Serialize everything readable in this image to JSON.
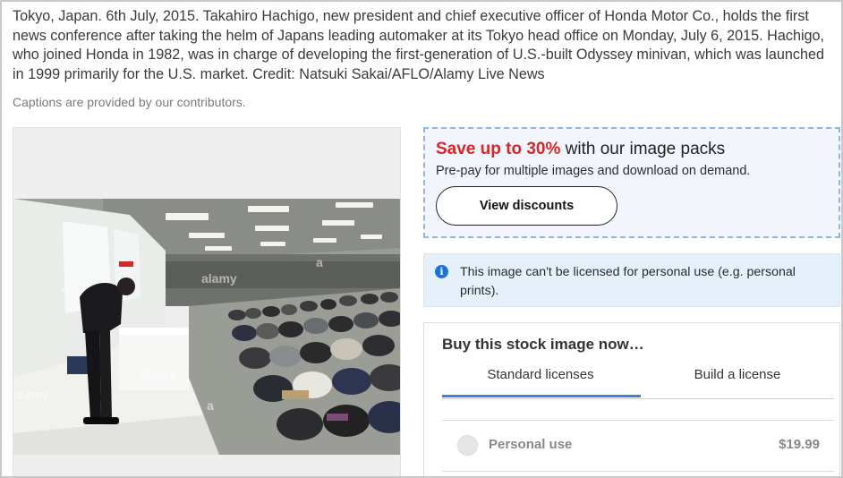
{
  "caption": {
    "text": "Tokyo, Japan. 6th July, 2015. Takahiro Hachigo, new president and chief executive officer of Honda Motor Co., holds the first news conference after taking the helm of Japans leading automaker at its Tokyo head office on Monday, July 6, 2015. Hachigo, who joined Honda in 1982, was in charge of developing the first-generation of U.S.-built Odyssey minivan, which was launched in 1999 primarily for the U.S. market. Credit: Natsuki Sakai/AFLO/Alamy Live News",
    "note": "Captions are provided by our contributors."
  },
  "image": {
    "watermark": "alamy",
    "subject": "Man bowing at a press conference before seated photographers"
  },
  "promo": {
    "title_accent": "Save up to 30%",
    "title_rest": " with our image packs",
    "subtitle": "Pre-pay for multiple images and download on demand.",
    "button_label": "View discounts",
    "accent_color": "#d42727"
  },
  "info": {
    "icon": "info-icon",
    "icon_glyph": "i",
    "text": "This image can't be licensed for personal use (e.g. personal prints)."
  },
  "buy": {
    "title": "Buy this stock image now…",
    "tabs": [
      {
        "label": "Standard licenses",
        "active": true
      },
      {
        "label": "Build a license",
        "active": false
      }
    ],
    "licenses": [
      {
        "label": "Personal use",
        "price": "$19.99",
        "selected": false,
        "disabled": true
      }
    ],
    "tab_accent_color": "#3b82d6"
  }
}
